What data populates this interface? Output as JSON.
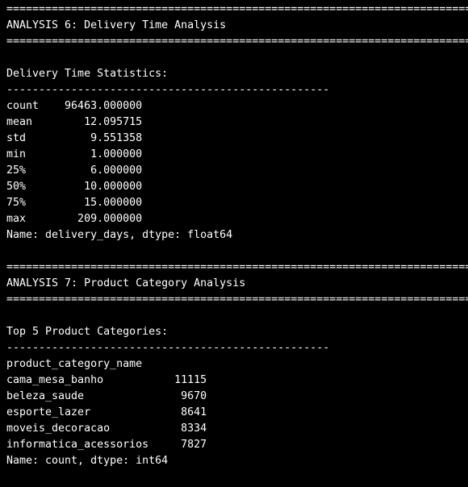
{
  "terminal": {
    "lines": [
      "================================================================================",
      "ANALYSIS 6: Delivery Time Analysis",
      "================================================================================",
      "",
      "Delivery Time Statistics:",
      "--------------------------------------------------",
      "count    96463.000000",
      "mean        12.095715",
      "std          9.551358",
      "min          1.000000",
      "25%          6.000000",
      "50%         10.000000",
      "75%         15.000000",
      "max        209.000000",
      "Name: delivery_days, dtype: float64",
      "",
      "================================================================================",
      "ANALYSIS 7: Product Category Analysis",
      "================================================================================",
      "",
      "Top 5 Product Categories:",
      "--------------------------------------------------",
      "product_category_name",
      "cama_mesa_banho           11115",
      "beleza_saude               9670",
      "esporte_lazer              8641",
      "moveis_decoracao           8334",
      "informatica_acessorios     7827",
      "Name: count, dtype: int64",
      ""
    ]
  }
}
